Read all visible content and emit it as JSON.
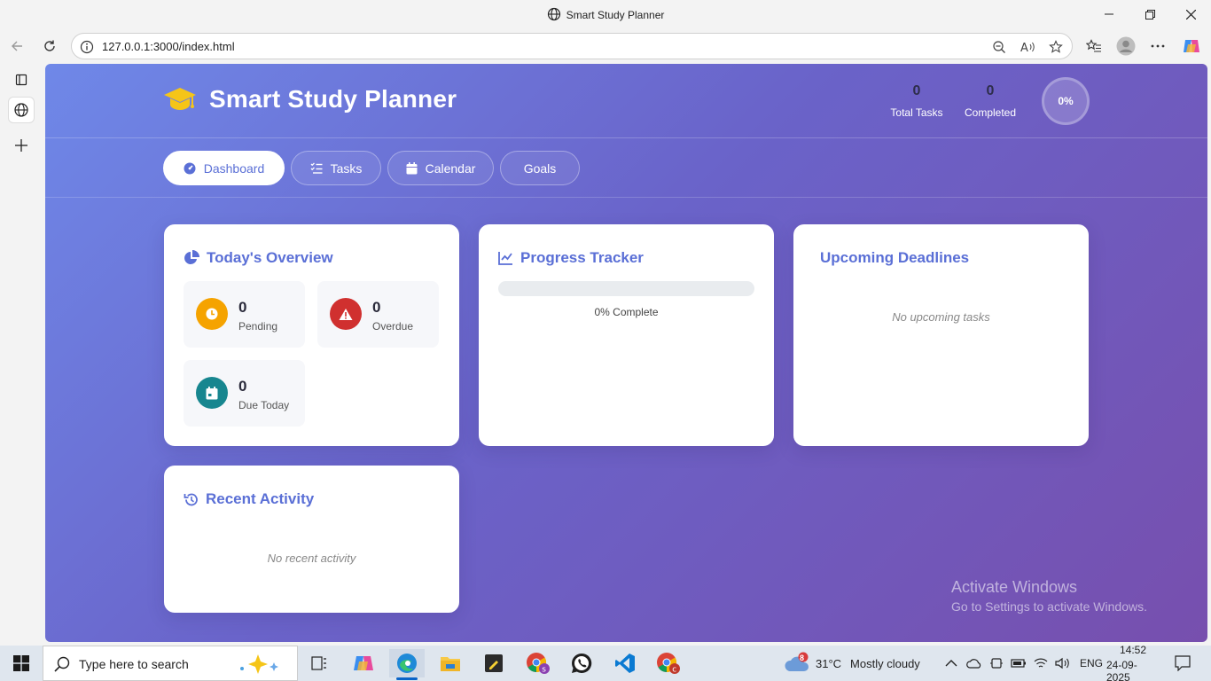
{
  "browser": {
    "window_title": "Smart Study Planner",
    "url": "127.0.0.1:3000/index.html"
  },
  "app": {
    "brand": "Smart Study Planner",
    "stats": {
      "total_tasks_value": "0",
      "total_tasks_label": "Total Tasks",
      "completed_value": "0",
      "completed_label": "Completed"
    },
    "progress_ring": {
      "label": "0%",
      "fraction": 0
    },
    "tabs": [
      {
        "label": "Dashboard",
        "active": true
      },
      {
        "label": "Tasks",
        "active": false
      },
      {
        "label": "Calendar",
        "active": false
      },
      {
        "label": "Goals",
        "active": false
      }
    ],
    "overview": {
      "title": "Today's Overview",
      "pending": {
        "value": "0",
        "label": "Pending",
        "color": "#f5a300"
      },
      "overdue": {
        "value": "0",
        "label": "Overdue",
        "color": "#d0302f"
      },
      "due_today": {
        "value": "0",
        "label": "Due Today",
        "color": "#17868f"
      }
    },
    "progress": {
      "title": "Progress Tracker",
      "percent": 0,
      "text": "0% Complete"
    },
    "deadlines": {
      "title": "Upcoming Deadlines",
      "empty": "No upcoming tasks"
    },
    "activity": {
      "title": "Recent Activity",
      "empty": "No recent activity"
    },
    "colors": {
      "accent": "#5a6fd6",
      "gradient_start": "#6f88e8",
      "gradient_end": "#774fae"
    }
  },
  "watermark": {
    "line1": "Activate Windows",
    "line2": "Go to Settings to activate Windows."
  },
  "taskbar": {
    "search_placeholder": "Type here to search",
    "weather_temp": "31°C",
    "weather_desc": "Mostly cloudy",
    "weather_badge": "8",
    "language": "ENG",
    "time": "14:52",
    "date": "24-09-2025"
  }
}
